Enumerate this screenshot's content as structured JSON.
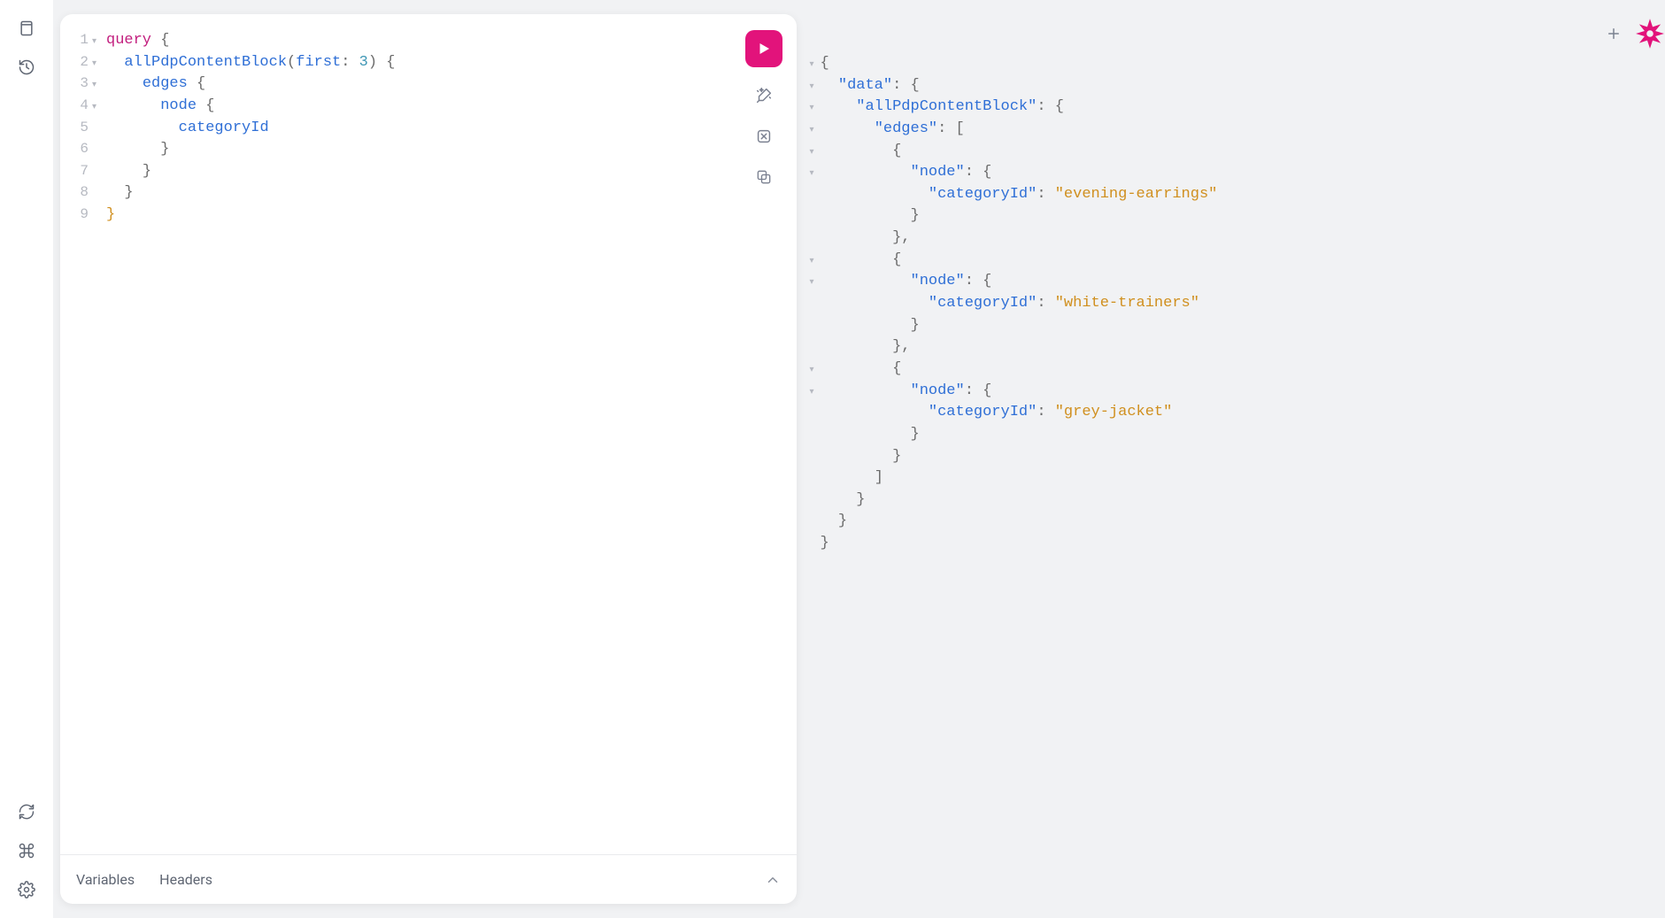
{
  "accent": "#e2137b",
  "left_rail": {
    "docs_icon": "docs",
    "history_icon": "history",
    "refresh_icon": "refresh",
    "shortcuts_icon": "shortcuts",
    "settings_icon": "settings"
  },
  "editor": {
    "actions": {
      "run": "run",
      "prettify": "prettify",
      "merge": "merge",
      "copy": "copy"
    },
    "footer": {
      "tab_variables": "Variables",
      "tab_headers": "Headers"
    },
    "query": {
      "lines": [
        {
          "n": 1,
          "fold": true,
          "indent": 0,
          "tokens": [
            [
              "keyword",
              "query"
            ],
            [
              "s",
              " "
            ],
            [
              "brace",
              "{"
            ]
          ]
        },
        {
          "n": 2,
          "fold": true,
          "indent": 1,
          "tokens": [
            [
              "field",
              "allPdpContentBlock"
            ],
            [
              "punct",
              "("
            ],
            [
              "arg",
              "first"
            ],
            [
              "punct",
              ":"
            ],
            [
              "s",
              " "
            ],
            [
              "num",
              "3"
            ],
            [
              "punct",
              ")"
            ],
            [
              "s",
              " "
            ],
            [
              "brace",
              "{"
            ]
          ]
        },
        {
          "n": 3,
          "fold": true,
          "indent": 2,
          "tokens": [
            [
              "field",
              "edges"
            ],
            [
              "s",
              " "
            ],
            [
              "brace",
              "{"
            ]
          ]
        },
        {
          "n": 4,
          "fold": true,
          "indent": 3,
          "tokens": [
            [
              "field",
              "node"
            ],
            [
              "s",
              " "
            ],
            [
              "brace",
              "{"
            ]
          ]
        },
        {
          "n": 5,
          "fold": false,
          "indent": 4,
          "tokens": [
            [
              "field",
              "categoryId"
            ]
          ]
        },
        {
          "n": 6,
          "fold": false,
          "indent": 3,
          "tokens": [
            [
              "brace",
              "}"
            ]
          ]
        },
        {
          "n": 7,
          "fold": false,
          "indent": 2,
          "tokens": [
            [
              "brace",
              "}"
            ]
          ]
        },
        {
          "n": 8,
          "fold": false,
          "indent": 1,
          "tokens": [
            [
              "brace",
              "}"
            ]
          ]
        },
        {
          "n": 9,
          "fold": false,
          "indent": 0,
          "tokens": [
            [
              "closeRoot",
              "}"
            ]
          ]
        }
      ]
    }
  },
  "result": {
    "json": {
      "data": {
        "allPdpContentBlock": {
          "edges": [
            {
              "node": {
                "categoryId": "evening-earrings"
              }
            },
            {
              "node": {
                "categoryId": "white-trainers"
              }
            },
            {
              "node": {
                "categoryId": "grey-jacket"
              }
            }
          ]
        }
      }
    },
    "lines": [
      {
        "fold": true,
        "indent": 0,
        "tokens": [
          [
            "brace",
            "{"
          ]
        ]
      },
      {
        "fold": true,
        "indent": 1,
        "tokens": [
          [
            "key",
            "\"data\""
          ],
          [
            "punct",
            ": "
          ],
          [
            "brace",
            "{"
          ]
        ]
      },
      {
        "fold": true,
        "indent": 2,
        "tokens": [
          [
            "key",
            "\"allPdpContentBlock\""
          ],
          [
            "punct",
            ": "
          ],
          [
            "brace",
            "{"
          ]
        ]
      },
      {
        "fold": true,
        "indent": 3,
        "tokens": [
          [
            "key",
            "\"edges\""
          ],
          [
            "punct",
            ": "
          ],
          [
            "brace",
            "["
          ]
        ]
      },
      {
        "fold": true,
        "indent": 4,
        "tokens": [
          [
            "brace",
            "{"
          ]
        ]
      },
      {
        "fold": true,
        "indent": 5,
        "tokens": [
          [
            "key",
            "\"node\""
          ],
          [
            "punct",
            ": "
          ],
          [
            "brace",
            "{"
          ]
        ]
      },
      {
        "fold": false,
        "indent": 6,
        "tokens": [
          [
            "key",
            "\"categoryId\""
          ],
          [
            "punct",
            ": "
          ],
          [
            "str",
            "\"evening-earrings\""
          ]
        ]
      },
      {
        "fold": false,
        "indent": 5,
        "tokens": [
          [
            "brace",
            "}"
          ]
        ]
      },
      {
        "fold": false,
        "indent": 4,
        "tokens": [
          [
            "brace",
            "}"
          ],
          [
            "punct",
            ","
          ]
        ]
      },
      {
        "fold": true,
        "indent": 4,
        "tokens": [
          [
            "brace",
            "{"
          ]
        ]
      },
      {
        "fold": true,
        "indent": 5,
        "tokens": [
          [
            "key",
            "\"node\""
          ],
          [
            "punct",
            ": "
          ],
          [
            "brace",
            "{"
          ]
        ]
      },
      {
        "fold": false,
        "indent": 6,
        "tokens": [
          [
            "key",
            "\"categoryId\""
          ],
          [
            "punct",
            ": "
          ],
          [
            "str",
            "\"white-trainers\""
          ]
        ]
      },
      {
        "fold": false,
        "indent": 5,
        "tokens": [
          [
            "brace",
            "}"
          ]
        ]
      },
      {
        "fold": false,
        "indent": 4,
        "tokens": [
          [
            "brace",
            "}"
          ],
          [
            "punct",
            ","
          ]
        ]
      },
      {
        "fold": true,
        "indent": 4,
        "tokens": [
          [
            "brace",
            "{"
          ]
        ]
      },
      {
        "fold": true,
        "indent": 5,
        "tokens": [
          [
            "key",
            "\"node\""
          ],
          [
            "punct",
            ": "
          ],
          [
            "brace",
            "{"
          ]
        ]
      },
      {
        "fold": false,
        "indent": 6,
        "tokens": [
          [
            "key",
            "\"categoryId\""
          ],
          [
            "punct",
            ": "
          ],
          [
            "str",
            "\"grey-jacket\""
          ]
        ]
      },
      {
        "fold": false,
        "indent": 5,
        "tokens": [
          [
            "brace",
            "}"
          ]
        ]
      },
      {
        "fold": false,
        "indent": 4,
        "tokens": [
          [
            "brace",
            "}"
          ]
        ]
      },
      {
        "fold": false,
        "indent": 3,
        "tokens": [
          [
            "brace",
            "]"
          ]
        ]
      },
      {
        "fold": false,
        "indent": 2,
        "tokens": [
          [
            "brace",
            "}"
          ]
        ]
      },
      {
        "fold": false,
        "indent": 1,
        "tokens": [
          [
            "brace",
            "}"
          ]
        ]
      },
      {
        "fold": false,
        "indent": 0,
        "tokens": [
          [
            "brace",
            "}"
          ]
        ]
      }
    ]
  },
  "right_rail": {
    "new_tab": "new",
    "logo": "graphiql"
  }
}
